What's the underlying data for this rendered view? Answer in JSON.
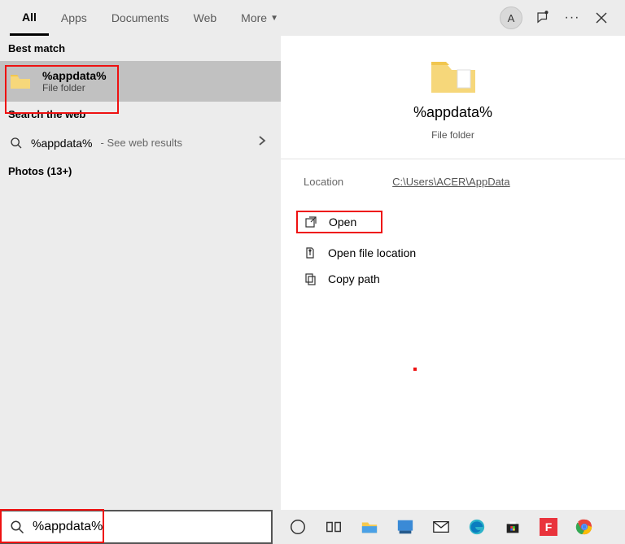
{
  "header": {
    "tabs": [
      "All",
      "Apps",
      "Documents",
      "Web",
      "More"
    ],
    "active_tab": 0,
    "avatar_letter": "A"
  },
  "left": {
    "best_match_label": "Best match",
    "best_match": {
      "title": "%appdata%",
      "subtitle": "File folder"
    },
    "search_web_label": "Search the web",
    "web": {
      "query": "%appdata%",
      "suffix": "- See web results"
    },
    "photos_label": "Photos (13+)"
  },
  "right": {
    "title": "%appdata%",
    "subtitle": "File folder",
    "location_label": "Location",
    "location_path": "C:\\Users\\ACER\\AppData",
    "actions": {
      "open": "Open",
      "open_location": "Open file location",
      "copy_path": "Copy path"
    }
  },
  "search": {
    "value": "%appdata%"
  }
}
